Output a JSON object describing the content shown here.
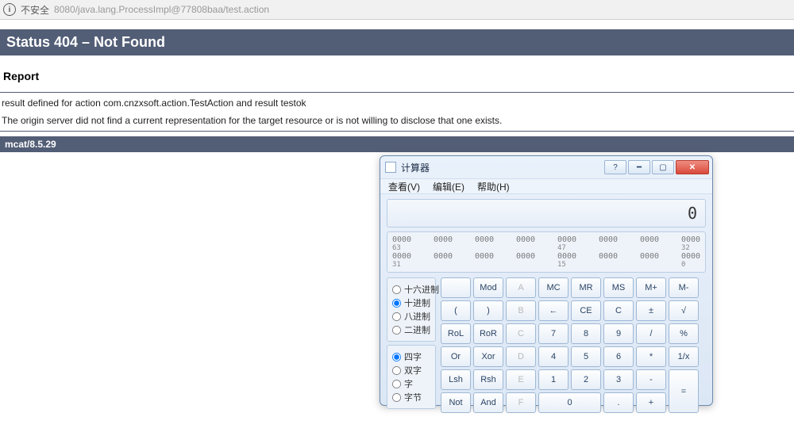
{
  "browser": {
    "insecure_label": "不安全",
    "url": "8080/java.lang.ProcessImpl@77808baa/test.action"
  },
  "page": {
    "status_heading": "Status 404 – Not Found",
    "report_label": "Report",
    "error_msg": "result defined for action com.cnzxsoft.action.TestAction and result testok",
    "origin_msg": "The origin server did not find a current representation for the target resource or is not willing to disclose that one exists.",
    "server_banner": "mcat/8.5.29"
  },
  "calc": {
    "title": "计算器",
    "menu": {
      "view": "查看(V)",
      "edit": "编辑(E)",
      "help": "帮助(H)"
    },
    "display": "0",
    "bit_word": "0000",
    "bit_indices": {
      "r1a": "63",
      "r1b": "47",
      "r1c": "32",
      "r2a": "31",
      "r2b": "15",
      "r2c": "0"
    },
    "base": {
      "hex": "十六进制",
      "dec": "十进制",
      "oct": "八进制",
      "bin": "二进制"
    },
    "word": {
      "qword": "四字",
      "dword": "双字",
      "wordlbl": "字",
      "byte": "字节"
    },
    "keys": {
      "mod": "Mod",
      "A": "A",
      "MC": "MC",
      "MR": "MR",
      "MS": "MS",
      "Mplus": "M+",
      "Mminus": "M-",
      "lparen": "(",
      "rparen": ")",
      "B": "B",
      "back": "←",
      "CE": "CE",
      "C": "C",
      "pm": "±",
      "sqrt": "√",
      "RoL": "RoL",
      "RoR": "RoR",
      "Cc": "C",
      "7": "7",
      "8": "8",
      "9": "9",
      "div": "/",
      "pct": "%",
      "Or": "Or",
      "Xor": "Xor",
      "D": "D",
      "4": "4",
      "5": "5",
      "6": "6",
      "mul": "*",
      "inv": "1/x",
      "Lsh": "Lsh",
      "Rsh": "Rsh",
      "E": "E",
      "1": "1",
      "2": "2",
      "3": "3",
      "minus": "-",
      "eq": "=",
      "Not": "Not",
      "And": "And",
      "F": "F",
      "0": "0",
      "dot": ".",
      "plus": "+"
    }
  }
}
